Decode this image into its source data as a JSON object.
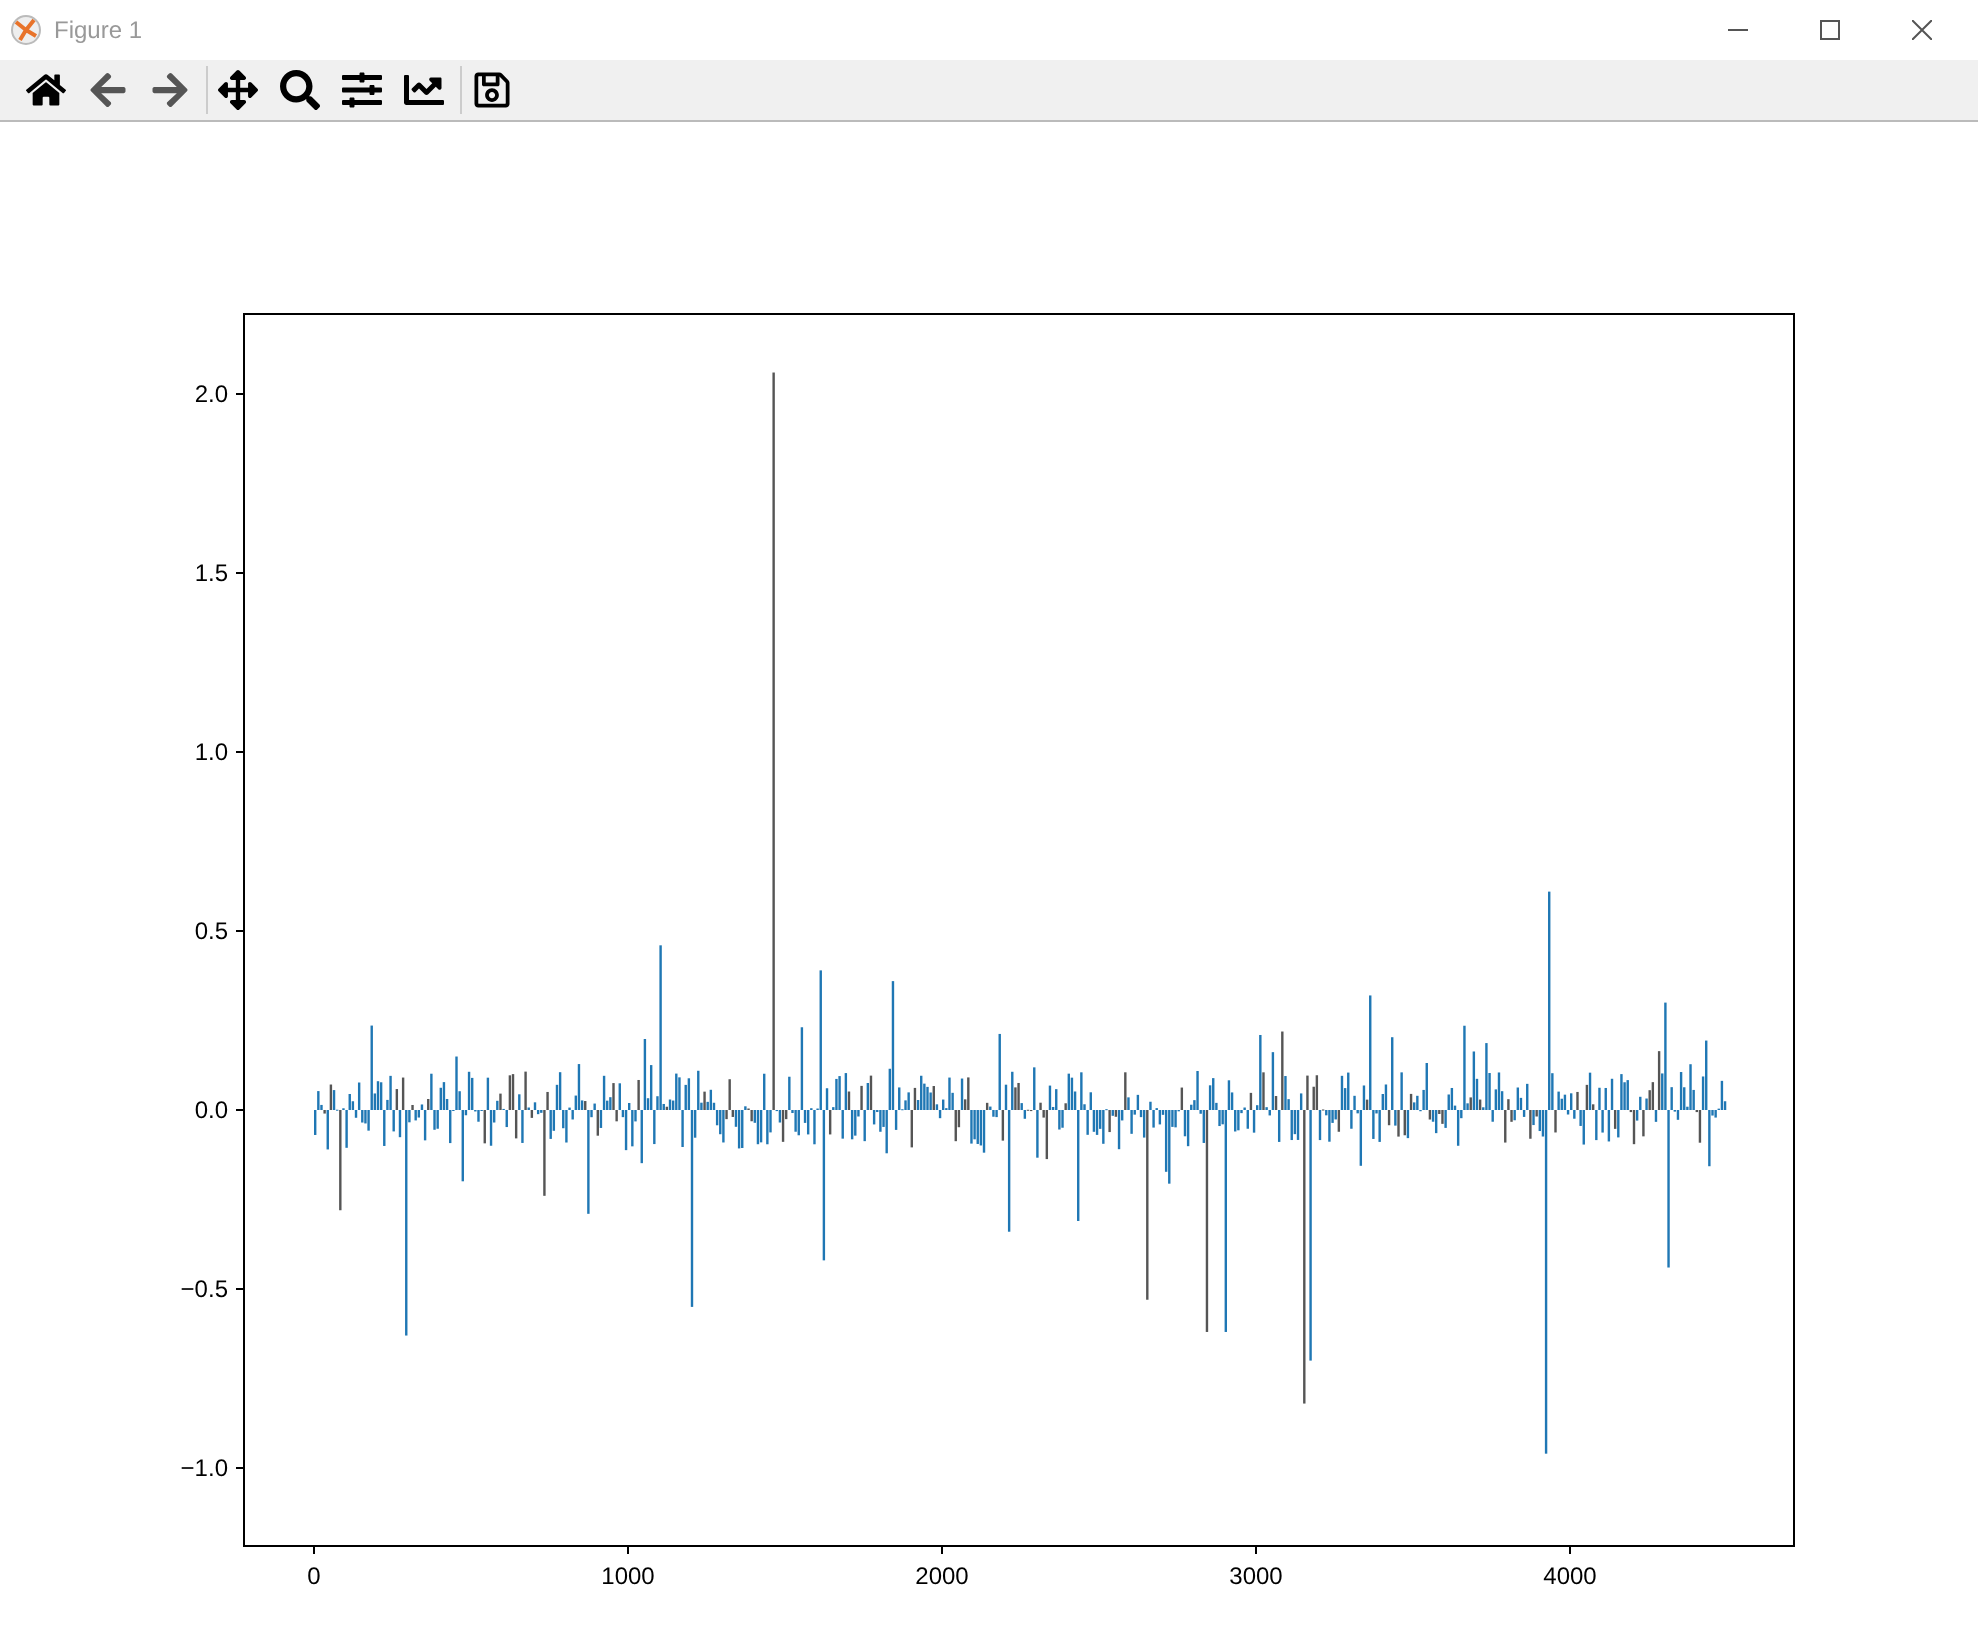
{
  "window": {
    "title": "Figure 1"
  },
  "plot": {
    "yticks": [
      "2.0",
      "1.5",
      "1.0",
      "0.5",
      "0.0",
      "−0.5",
      "−1.0"
    ],
    "xticks": [
      "0",
      "1000",
      "2000",
      "3000",
      "4000"
    ]
  }
}
